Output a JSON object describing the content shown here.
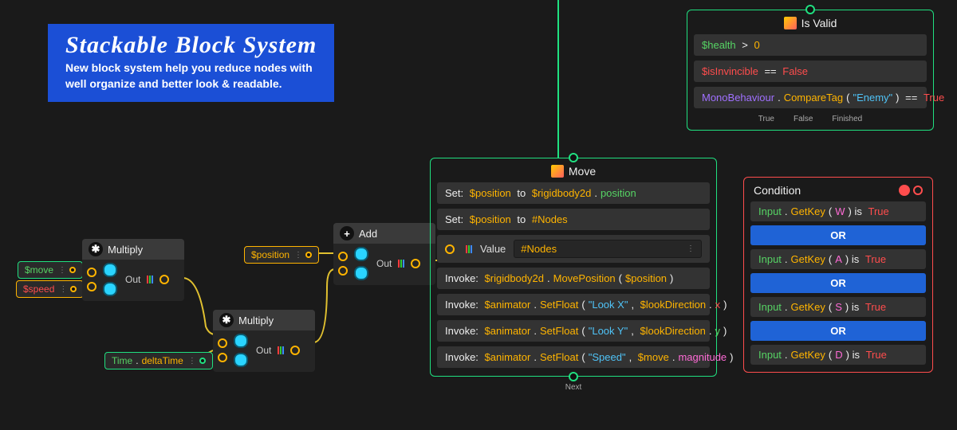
{
  "banner": {
    "title": "Stackable Block System",
    "line1": "New block system help you reduce nodes with",
    "line2": "well organize and better look & readable."
  },
  "nodes": {
    "multiply1": {
      "title": "Multiply",
      "out": "Out"
    },
    "multiply2": {
      "title": "Multiply",
      "out": "Out"
    },
    "add": {
      "title": "Add",
      "out": "Out"
    }
  },
  "pills": {
    "move": {
      "text": "$move",
      "color": "tk-green"
    },
    "speed": {
      "text": "$speed",
      "color": "tk-red"
    },
    "time": {
      "pre": "Time",
      "post": "deltaTime"
    },
    "position": {
      "text": "$position"
    }
  },
  "move": {
    "title": "Move",
    "rows": [
      {
        "kind": "set",
        "tokens": [
          {
            "t": "Set: ",
            "c": "tk-white"
          },
          {
            "t": "$position",
            "c": "tk-orange"
          },
          {
            "t": " to ",
            "c": "tk-white"
          },
          {
            "t": "$rigidbody2d",
            "c": "tk-orange"
          },
          {
            "t": ".",
            "c": "tk-white"
          },
          {
            "t": "position",
            "c": "tk-green"
          }
        ]
      },
      {
        "kind": "set",
        "tokens": [
          {
            "t": "Set: ",
            "c": "tk-white"
          },
          {
            "t": "$position",
            "c": "tk-orange"
          },
          {
            "t": " to ",
            "c": "tk-white"
          },
          {
            "t": "#Nodes",
            "c": "tk-orange"
          }
        ]
      },
      {
        "kind": "value",
        "label": "Value",
        "value": "#Nodes"
      },
      {
        "kind": "invoke",
        "tokens": [
          {
            "t": "Invoke: ",
            "c": "tk-white"
          },
          {
            "t": "$rigidbody2d",
            "c": "tk-orange"
          },
          {
            "t": ".",
            "c": "tk-white"
          },
          {
            "t": "MovePosition",
            "c": "tk-orange"
          },
          {
            "t": "(",
            "c": "tk-white"
          },
          {
            "t": "$position",
            "c": "tk-orange"
          },
          {
            "t": ")",
            "c": "tk-white"
          }
        ]
      },
      {
        "kind": "invoke",
        "tokens": [
          {
            "t": "Invoke: ",
            "c": "tk-white"
          },
          {
            "t": "$animator",
            "c": "tk-orange"
          },
          {
            "t": ".",
            "c": "tk-white"
          },
          {
            "t": "SetFloat",
            "c": "tk-orange"
          },
          {
            "t": "(",
            "c": "tk-white"
          },
          {
            "t": "\"Look X\"",
            "c": "tk-cyan"
          },
          {
            "t": ", ",
            "c": "tk-white"
          },
          {
            "t": "$lookDirection",
            "c": "tk-orange"
          },
          {
            "t": ".",
            "c": "tk-white"
          },
          {
            "t": "x",
            "c": "tk-red"
          },
          {
            "t": ")",
            "c": "tk-white"
          }
        ]
      },
      {
        "kind": "invoke",
        "tokens": [
          {
            "t": "Invoke: ",
            "c": "tk-white"
          },
          {
            "t": "$animator",
            "c": "tk-orange"
          },
          {
            "t": ".",
            "c": "tk-white"
          },
          {
            "t": "SetFloat",
            "c": "tk-orange"
          },
          {
            "t": "(",
            "c": "tk-white"
          },
          {
            "t": "\"Look Y\"",
            "c": "tk-cyan"
          },
          {
            "t": ", ",
            "c": "tk-white"
          },
          {
            "t": "$lookDirection",
            "c": "tk-orange"
          },
          {
            "t": ".",
            "c": "tk-white"
          },
          {
            "t": "y",
            "c": "tk-green"
          },
          {
            "t": ")",
            "c": "tk-white"
          }
        ]
      },
      {
        "kind": "invoke",
        "tokens": [
          {
            "t": "Invoke: ",
            "c": "tk-white"
          },
          {
            "t": "$animator",
            "c": "tk-orange"
          },
          {
            "t": ".",
            "c": "tk-white"
          },
          {
            "t": "SetFloat",
            "c": "tk-orange"
          },
          {
            "t": "(",
            "c": "tk-white"
          },
          {
            "t": "\"Speed\"",
            "c": "tk-cyan"
          },
          {
            "t": ", ",
            "c": "tk-white"
          },
          {
            "t": "$move",
            "c": "tk-orange"
          },
          {
            "t": ".",
            "c": "tk-white"
          },
          {
            "t": "magnitude",
            "c": "tk-pink"
          },
          {
            "t": ")",
            "c": "tk-white"
          }
        ]
      }
    ],
    "next_label": "Next"
  },
  "isvalid": {
    "title": "Is Valid",
    "rows": [
      [
        {
          "t": "$health",
          "c": "tk-green"
        },
        {
          "t": " > ",
          "c": "tk-white"
        },
        {
          "t": "0",
          "c": "tk-orange"
        }
      ],
      [
        {
          "t": "$isInvincible",
          "c": "tk-red"
        },
        {
          "t": " == ",
          "c": "tk-white"
        },
        {
          "t": "False",
          "c": "tk-red"
        }
      ],
      [
        {
          "t": "MonoBehaviour",
          "c": "tk-purple"
        },
        {
          "t": ".",
          "c": "tk-white"
        },
        {
          "t": "CompareTag",
          "c": "tk-orange"
        },
        {
          "t": "(",
          "c": "tk-white"
        },
        {
          "t": "\"Enemy\"",
          "c": "tk-cyan"
        },
        {
          "t": ")",
          "c": "tk-white"
        },
        {
          "t": " == ",
          "c": "tk-white"
        },
        {
          "t": "True",
          "c": "tk-red"
        }
      ]
    ],
    "footer": [
      "True",
      "False",
      "Finished"
    ]
  },
  "condition": {
    "title": "Condition",
    "rows": [
      {
        "kind": "expr",
        "tokens": [
          {
            "t": "Input",
            "c": "tk-green"
          },
          {
            "t": ".",
            "c": "tk-white"
          },
          {
            "t": "GetKey",
            "c": "tk-orange"
          },
          {
            "t": "(",
            "c": "tk-white"
          },
          {
            "t": "W",
            "c": "tk-pink"
          },
          {
            "t": ") is ",
            "c": "tk-white"
          },
          {
            "t": "True",
            "c": "tk-red"
          }
        ]
      },
      {
        "kind": "or",
        "label": "OR"
      },
      {
        "kind": "expr",
        "tokens": [
          {
            "t": "Input",
            "c": "tk-green"
          },
          {
            "t": ".",
            "c": "tk-white"
          },
          {
            "t": "GetKey",
            "c": "tk-orange"
          },
          {
            "t": "(",
            "c": "tk-white"
          },
          {
            "t": "A",
            "c": "tk-pink"
          },
          {
            "t": ") is ",
            "c": "tk-white"
          },
          {
            "t": "True",
            "c": "tk-red"
          }
        ]
      },
      {
        "kind": "or",
        "label": "OR"
      },
      {
        "kind": "expr",
        "tokens": [
          {
            "t": "Input",
            "c": "tk-green"
          },
          {
            "t": ".",
            "c": "tk-white"
          },
          {
            "t": "GetKey",
            "c": "tk-orange"
          },
          {
            "t": "(",
            "c": "tk-white"
          },
          {
            "t": "S",
            "c": "tk-pink"
          },
          {
            "t": ") is ",
            "c": "tk-white"
          },
          {
            "t": "True",
            "c": "tk-red"
          }
        ]
      },
      {
        "kind": "or",
        "label": "OR"
      },
      {
        "kind": "expr",
        "tokens": [
          {
            "t": "Input",
            "c": "tk-green"
          },
          {
            "t": ".",
            "c": "tk-white"
          },
          {
            "t": "GetKey",
            "c": "tk-orange"
          },
          {
            "t": "(",
            "c": "tk-white"
          },
          {
            "t": "D",
            "c": "tk-pink"
          },
          {
            "t": ") is ",
            "c": "tk-white"
          },
          {
            "t": "True",
            "c": "tk-red"
          }
        ]
      }
    ]
  }
}
